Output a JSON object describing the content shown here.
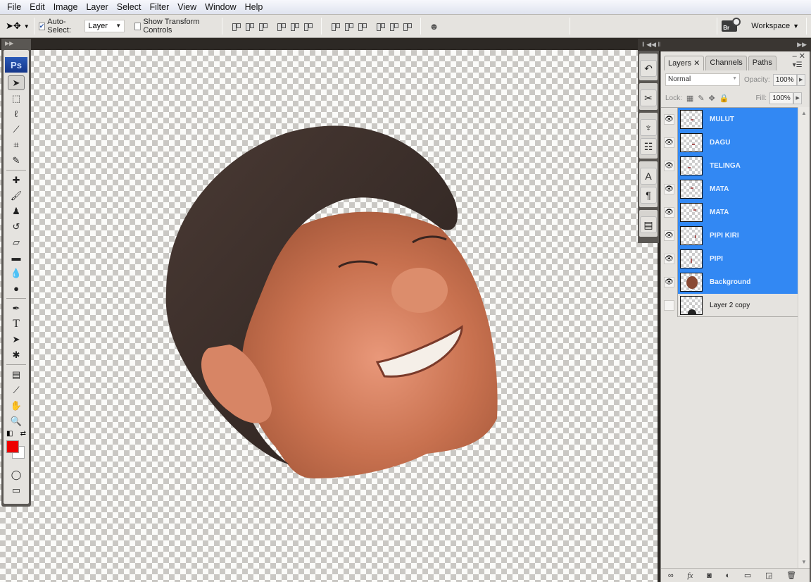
{
  "menu": [
    "File",
    "Edit",
    "Image",
    "Layer",
    "Select",
    "Filter",
    "View",
    "Window",
    "Help"
  ],
  "options": {
    "auto_select_label": "Auto-Select:",
    "auto_select_checked": true,
    "auto_select_value": "Layer",
    "show_transform_label": "Show Transform Controls",
    "show_transform_checked": false,
    "workspace_label": "Workspace",
    "bridge_label": "Br"
  },
  "tools_panel": {
    "logo": "Ps",
    "foreground_color": "#ee0000",
    "background_color": "#ffffff"
  },
  "layers_panel": {
    "tabs": [
      "Layers",
      "Channels",
      "Paths"
    ],
    "active_tab": "Layers",
    "blend_mode": "Normal",
    "opacity_label": "Opacity:",
    "opacity": "100%",
    "lock_label": "Lock:",
    "fill_label": "Fill:",
    "fill": "100%",
    "selection_color": "#3288f3",
    "layers": [
      {
        "name": "MULUT",
        "visible": true,
        "selected": true
      },
      {
        "name": "DAGU",
        "visible": true,
        "selected": true
      },
      {
        "name": "TELINGA",
        "visible": true,
        "selected": true
      },
      {
        "name": "MATA",
        "visible": true,
        "selected": true
      },
      {
        "name": "MATA",
        "visible": true,
        "selected": true
      },
      {
        "name": "PIPI KIRI",
        "visible": true,
        "selected": true
      },
      {
        "name": "PIPI",
        "visible": true,
        "selected": true
      },
      {
        "name": "Background",
        "visible": true,
        "selected": true
      },
      {
        "name": "Layer 2 copy",
        "visible": false,
        "selected": false
      }
    ]
  }
}
